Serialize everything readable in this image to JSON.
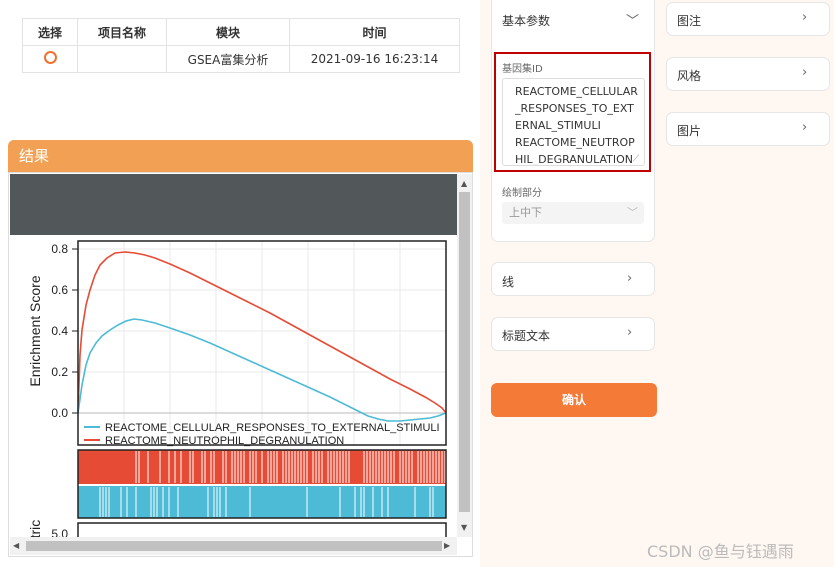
{
  "table": {
    "headers": [
      "选择",
      "项目名称",
      "模块",
      "时间"
    ],
    "row": {
      "project": "",
      "module": "GSEA富集分析",
      "time": "2021-09-16 16:23:14"
    }
  },
  "result": {
    "title": "结果",
    "plot": {
      "ylabel": "Enrichment Score",
      "ylabel_lower_fragment": "etric",
      "y_ticks": [
        "0.8",
        "0.6",
        "0.4",
        "0.2",
        "0.0"
      ],
      "lower_tick_fragment": "5.0",
      "legend": [
        {
          "label": "REACTOME_CELLULAR_RESPONSES_TO_EXTERNAL_STIMULI",
          "color": "#4dbbd5"
        },
        {
          "label": "REACTOME_NEUTROPHIL_DEGRANULATION",
          "color": "#e64b35"
        }
      ]
    }
  },
  "settings": {
    "basic_params": "基本参数",
    "gene_set_label": "基因集ID",
    "gene_set_value": "REACTOME_CELLULAR_RESPONSES_TO_EXTERNAL_STIMULI\nREACTOME_NEUTROPHIL_DEGRANULATION",
    "draw_part_label": "绘制部分",
    "draw_part_value": "上中下",
    "line": "线",
    "title_text": "标题文本",
    "confirm": "确认",
    "legend": "图注",
    "style": "风格",
    "image": "图片"
  },
  "watermark": "CSDN @鱼与钰遇雨",
  "colors": {
    "accent": "#f47a38",
    "header": "#f2a054",
    "highlight_border": "#c00000"
  },
  "icons": {
    "chevron": "chevron-right-icon",
    "dropdown": "chevron-down-icon"
  }
}
